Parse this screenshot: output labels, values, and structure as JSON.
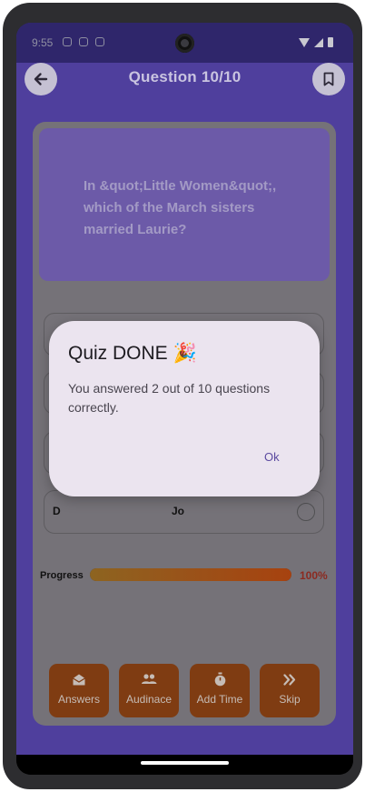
{
  "status_bar": {
    "time": "9:55",
    "left_icons": [
      "shield-icon",
      "sim-icon",
      "sync-icon"
    ],
    "right_icons": [
      "wifi-icon",
      "signal-icon",
      "battery-icon"
    ]
  },
  "app_bar": {
    "title": "Question 10/10",
    "back_icon": "arrow-left-icon",
    "bookmark_icon": "bookmark-icon"
  },
  "question": {
    "text": "In &quot;Little Women&quot;, which of the March sisters married Laurie?"
  },
  "options": [
    {
      "letter": "",
      "text": ""
    },
    {
      "letter": "",
      "text": ""
    },
    {
      "letter": "",
      "text": ""
    },
    {
      "letter": "D",
      "text": "Jo"
    }
  ],
  "progress": {
    "label": "Progress",
    "percent_text": "100%",
    "value": 1.0
  },
  "actions": [
    {
      "label": "Answers",
      "icon": "mail-open-icon"
    },
    {
      "label": "Audinace",
      "icon": "people-icon"
    },
    {
      "label": "Add Time",
      "icon": "stopwatch-icon"
    },
    {
      "label": "Skip",
      "icon": "double-chevron-right-icon"
    }
  ],
  "dialog": {
    "title": "Quiz DONE 🎉",
    "body": "You answered 2 out of 10 questions correctly.",
    "ok_label": "Ok"
  },
  "colors": {
    "app_background": "#4f3f9d",
    "accent": "#5b4aa0",
    "action_button": "#7f3c12",
    "dialog_background": "#ebe4ef"
  }
}
